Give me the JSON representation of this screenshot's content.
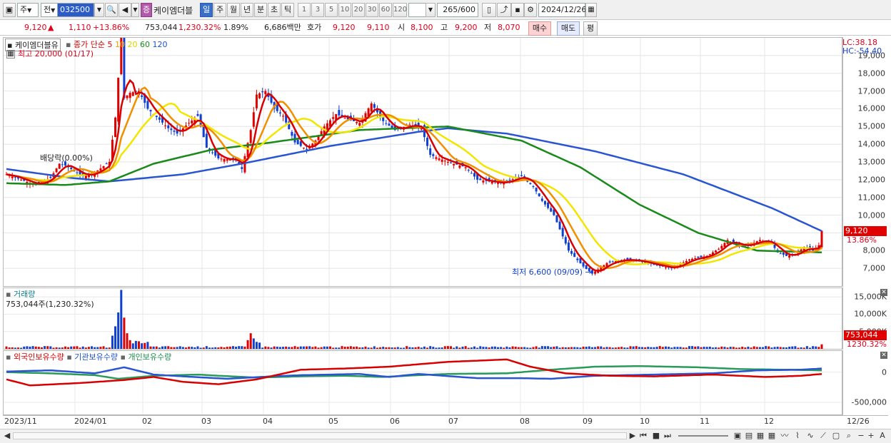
{
  "toolbar": {
    "market_mode": "주",
    "market_all": "전",
    "code_input": "032500",
    "name_badge": "증",
    "stock_name": "케이엠더블",
    "period_buttons": [
      "일",
      "주",
      "월",
      "년",
      "분",
      "초",
      "틱"
    ],
    "interval_buttons": [
      "1",
      "3",
      "5",
      "10",
      "20",
      "30",
      "60",
      "120"
    ],
    "count": "265",
    "count_total": "/600",
    "date": "2024/12/26"
  },
  "quote": {
    "price": "9,120",
    "change": "1,110",
    "change_pct": "+13.86%",
    "volume": "753,044",
    "volume_pct": "1,230.32%",
    "turnover_pct": "1.89%",
    "trade_value": "6,686백만",
    "ask_label": "호가",
    "ask_price": "9,120",
    "bid_price": "9,110",
    "open_label": "시",
    "open": "8,100",
    "high_label": "고",
    "high": "9,200",
    "low_label": "저",
    "low": "8,070",
    "buy_label": "매수",
    "sell_label": "매도",
    "eval_label": "평"
  },
  "price_pane": {
    "name": "케이엠더블유",
    "legend": {
      "title": "종가 단순",
      "ma5": "5",
      "ma10": "10",
      "ma20": "20",
      "ma60": "60",
      "ma120": "120"
    },
    "high_note": "최고 20,000 (01/17)",
    "dividend_note": "배당락(0.00%)",
    "low_note": "최저 6,600 (09/09)",
    "lc_label": "LC:38.18",
    "hc_label": "HC:-54.40",
    "price_badge": "9,120",
    "pct_label": "13.86%"
  },
  "volume_pane": {
    "title": "거래량",
    "value_label": "753,044주(1,230.32%)",
    "badge_value": "753,044",
    "badge_pct": "1230.32%"
  },
  "holdings_pane": {
    "foreign": "외국인보유수량",
    "institution": "기관보유수량",
    "individual": "개인보유수량"
  },
  "x_labels": [
    "2023/11",
    "2024/01",
    "02",
    "03",
    "04",
    "05",
    "06",
    "07",
    "08",
    "09",
    "10",
    "11",
    "12",
    "12/26"
  ],
  "chart_data": {
    "type": "candlestick",
    "price_axis": {
      "min": 6000,
      "max": 20000,
      "ticks": [
        "19,000",
        "18,000",
        "17,000",
        "16,000",
        "15,000",
        "14,000",
        "13,000",
        "12,000",
        "11,000",
        "10,000",
        "9,000",
        "8,000",
        "7,000"
      ]
    },
    "volume_axis": {
      "ticks": [
        "15,000K",
        "10,000K",
        "5,000K"
      ]
    },
    "holdings_axis": {
      "ticks": [
        "0",
        "-500,000"
      ]
    },
    "price_keypoints": [
      [
        0,
        12300
      ],
      [
        5,
        12000
      ],
      [
        10,
        11700
      ],
      [
        15,
        12100
      ],
      [
        18,
        12900
      ],
      [
        20,
        12800
      ],
      [
        23,
        12500
      ],
      [
        26,
        12200
      ],
      [
        30,
        12400
      ],
      [
        35,
        13000
      ],
      [
        37,
        15500
      ],
      [
        39,
        20000
      ],
      [
        40,
        16600
      ],
      [
        42,
        16900
      ],
      [
        45,
        17000
      ],
      [
        48,
        16000
      ],
      [
        50,
        15700
      ],
      [
        55,
        14900
      ],
      [
        58,
        14600
      ],
      [
        62,
        15200
      ],
      [
        65,
        15600
      ],
      [
        68,
        13800
      ],
      [
        72,
        13200
      ],
      [
        78,
        13100
      ],
      [
        80,
        12600
      ],
      [
        83,
        14800
      ],
      [
        85,
        16800
      ],
      [
        88,
        17000
      ],
      [
        91,
        16000
      ],
      [
        94,
        15600
      ],
      [
        98,
        14100
      ],
      [
        102,
        13700
      ],
      [
        105,
        14200
      ],
      [
        108,
        15000
      ],
      [
        112,
        15700
      ],
      [
        116,
        15400
      ],
      [
        120,
        15200
      ],
      [
        124,
        16300
      ],
      [
        128,
        15300
      ],
      [
        132,
        14800
      ],
      [
        137,
        15100
      ],
      [
        141,
        14900
      ],
      [
        144,
        13400
      ],
      [
        150,
        13000
      ],
      [
        156,
        12700
      ],
      [
        160,
        12000
      ],
      [
        168,
        11800
      ],
      [
        175,
        12200
      ],
      [
        179,
        11600
      ],
      [
        182,
        10800
      ],
      [
        186,
        10000
      ],
      [
        191,
        8000
      ],
      [
        196,
        7100
      ],
      [
        199,
        6700
      ],
      [
        204,
        7300
      ],
      [
        210,
        7500
      ],
      [
        215,
        7400
      ],
      [
        220,
        7200
      ],
      [
        226,
        7000
      ],
      [
        232,
        7500
      ],
      [
        238,
        7700
      ],
      [
        242,
        8100
      ],
      [
        245,
        8600
      ],
      [
        248,
        8300
      ],
      [
        252,
        8300
      ],
      [
        256,
        8600
      ],
      [
        260,
        8400
      ],
      [
        262,
        7900
      ],
      [
        265,
        7700
      ],
      [
        268,
        7800
      ],
      [
        271,
        8200
      ],
      [
        274,
        8000
      ],
      [
        276,
        8300
      ],
      [
        277,
        9120
      ]
    ],
    "ma120_keypoints": [
      [
        0,
        12600
      ],
      [
        22,
        12100
      ],
      [
        35,
        11900
      ],
      [
        60,
        12300
      ],
      [
        80,
        12900
      ],
      [
        110,
        13900
      ],
      [
        140,
        14700
      ],
      [
        150,
        14900
      ],
      [
        170,
        14600
      ],
      [
        200,
        13600
      ],
      [
        230,
        12300
      ],
      [
        260,
        10400
      ],
      [
        277,
        9100
      ]
    ],
    "ma60_keypoints": [
      [
        0,
        11800
      ],
      [
        20,
        11700
      ],
      [
        35,
        11900
      ],
      [
        50,
        12900
      ],
      [
        70,
        13700
      ],
      [
        90,
        14100
      ],
      [
        120,
        14800
      ],
      [
        150,
        15000
      ],
      [
        175,
        14200
      ],
      [
        195,
        12700
      ],
      [
        215,
        10600
      ],
      [
        235,
        9000
      ],
      [
        255,
        8000
      ],
      [
        277,
        7900
      ]
    ],
    "holdings_foreign_keypoints": [
      [
        0,
        -120000
      ],
      [
        8,
        -220000
      ],
      [
        25,
        -180000
      ],
      [
        40,
        -130000
      ],
      [
        50,
        -80000
      ],
      [
        60,
        -160000
      ],
      [
        72,
        -200000
      ],
      [
        85,
        -120000
      ],
      [
        100,
        40000
      ],
      [
        115,
        60000
      ],
      [
        130,
        90000
      ],
      [
        150,
        170000
      ],
      [
        170,
        210000
      ],
      [
        178,
        90000
      ],
      [
        190,
        -20000
      ],
      [
        205,
        -60000
      ],
      [
        220,
        -70000
      ],
      [
        240,
        -40000
      ],
      [
        258,
        -80000
      ],
      [
        270,
        -60000
      ],
      [
        277,
        -30000
      ]
    ],
    "holdings_institution_keypoints": [
      [
        0,
        10000
      ],
      [
        15,
        30000
      ],
      [
        30,
        -20000
      ],
      [
        40,
        80000
      ],
      [
        50,
        -40000
      ],
      [
        60,
        -70000
      ],
      [
        75,
        -110000
      ],
      [
        90,
        -70000
      ],
      [
        100,
        -50000
      ],
      [
        120,
        -30000
      ],
      [
        130,
        -80000
      ],
      [
        140,
        -30000
      ],
      [
        160,
        -100000
      ],
      [
        175,
        -100000
      ],
      [
        185,
        -110000
      ],
      [
        200,
        -60000
      ],
      [
        220,
        -40000
      ],
      [
        240,
        -20000
      ],
      [
        255,
        30000
      ],
      [
        270,
        40000
      ],
      [
        277,
        60000
      ]
    ],
    "holdings_individual_keypoints": [
      [
        0,
        0
      ],
      [
        15,
        -20000
      ],
      [
        30,
        -50000
      ],
      [
        38,
        -110000
      ],
      [
        50,
        -60000
      ],
      [
        65,
        -40000
      ],
      [
        72,
        -60000
      ],
      [
        85,
        -90000
      ],
      [
        100,
        -70000
      ],
      [
        115,
        -60000
      ],
      [
        128,
        -80000
      ],
      [
        140,
        -50000
      ],
      [
        150,
        -30000
      ],
      [
        170,
        -20000
      ],
      [
        185,
        40000
      ],
      [
        200,
        90000
      ],
      [
        215,
        100000
      ],
      [
        235,
        80000
      ],
      [
        250,
        50000
      ],
      [
        265,
        40000
      ],
      [
        277,
        30000
      ]
    ]
  }
}
